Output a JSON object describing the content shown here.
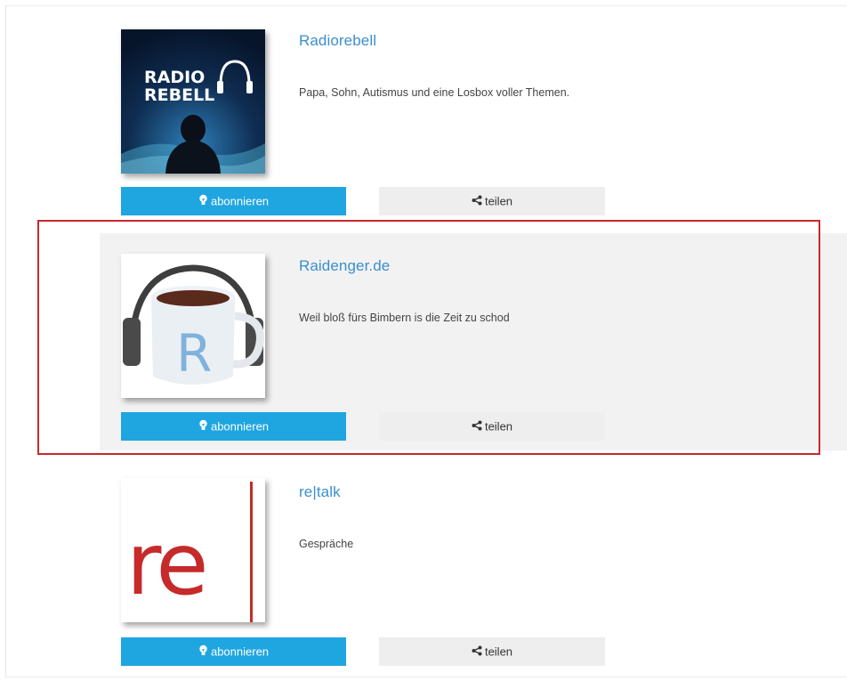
{
  "podcasts": [
    {
      "title": "Radiorebell",
      "description": "Papa, Sohn, Autismus und eine Losbox voller Themen.",
      "cover_text_line1": "RADIO",
      "cover_text_line2": "REBELL",
      "subscribe_label": "abonnieren",
      "share_label": "teilen"
    },
    {
      "title": "Raidenger.de",
      "description": "Weil bloß fürs Bimbern is die Zeit zu schod",
      "cover_text": "R",
      "subscribe_label": "abonnieren",
      "share_label": "teilen",
      "highlighted": true
    },
    {
      "title": "re|talk",
      "description": "Gespräche",
      "cover_text": "re",
      "subscribe_label": "abonnieren",
      "share_label": "teilen"
    }
  ],
  "colors": {
    "title_link": "#3a8fd0",
    "subscribe_button": "#1fa5e0",
    "share_button": "#eeeeee",
    "highlight_border": "#c9282d",
    "highlight_background": "#f2f2f2"
  },
  "icons": {
    "subscribe": "lightbulb-icon",
    "share": "share-icon"
  }
}
